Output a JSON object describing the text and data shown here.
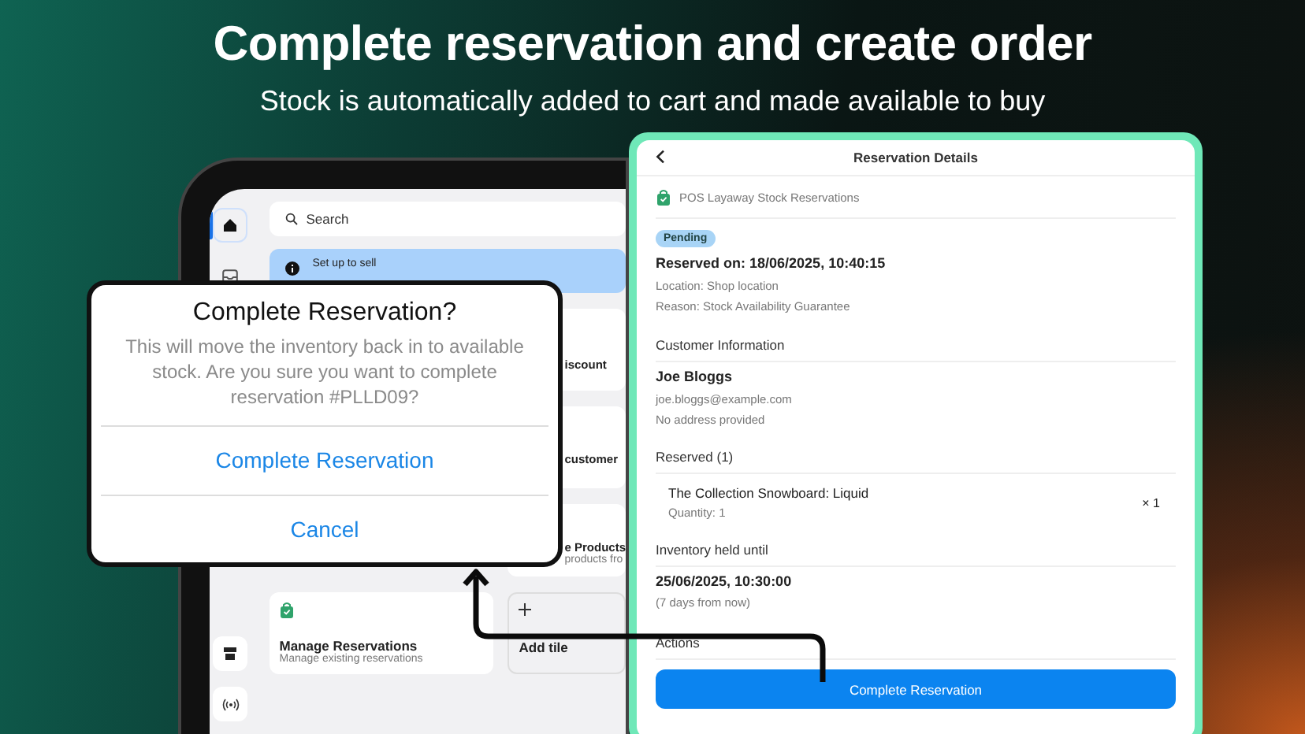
{
  "header": {
    "title": "Complete reservation and create order",
    "subtitle": "Stock is automatically added to cart and made available to buy"
  },
  "tablet": {
    "sidebar": [
      {
        "kind": "home",
        "selected": true
      },
      {
        "kind": "inbox",
        "selected": false
      },
      {
        "kind": "store",
        "selected": false
      },
      {
        "kind": "signal",
        "selected": false
      }
    ],
    "search": {
      "placeholder": "Search"
    },
    "banner": {
      "title": "Set up to sell"
    },
    "side_tiles": [
      {
        "title": "iscount"
      },
      {
        "title": "customer"
      },
      {
        "title": "e Products",
        "subtitle": "products fro"
      }
    ],
    "bottom_tiles": [
      {
        "kind": "reservations",
        "title": "Manage Reservations",
        "subtitle": "Manage existing reservations"
      },
      {
        "kind": "add",
        "title": "Add tile"
      }
    ]
  },
  "dialog": {
    "title": "Complete Reservation?",
    "message": "This will move the inventory back in to available stock. Are you sure you want to complete reservation #PLLD09?",
    "actions": [
      {
        "label": "Complete Reservation"
      },
      {
        "label": "Cancel"
      }
    ]
  },
  "details": {
    "title": "Reservation Details",
    "source": "POS Layaway Stock Reservations",
    "status": "Pending",
    "reserved_on": "Reserved on: 18/06/2025, 10:40:15",
    "location": "Location: Shop location",
    "reason": "Reason: Stock Availability Guarantee",
    "customer": {
      "heading": "Customer Information",
      "name": "Joe Bloggs",
      "email": "joe.bloggs@example.com",
      "address": "No address provided"
    },
    "reserved": {
      "heading": "Reserved (1)",
      "items": [
        {
          "name": "The Collection Snowboard: Liquid",
          "quantity": "Quantity: 1",
          "count": "× 1"
        }
      ]
    },
    "held": {
      "heading": "Inventory held until",
      "date": "25/06/2025, 10:30:00",
      "note": "(7 days from now)"
    },
    "actions": {
      "heading": "Actions",
      "button": "Complete Reservation"
    }
  }
}
